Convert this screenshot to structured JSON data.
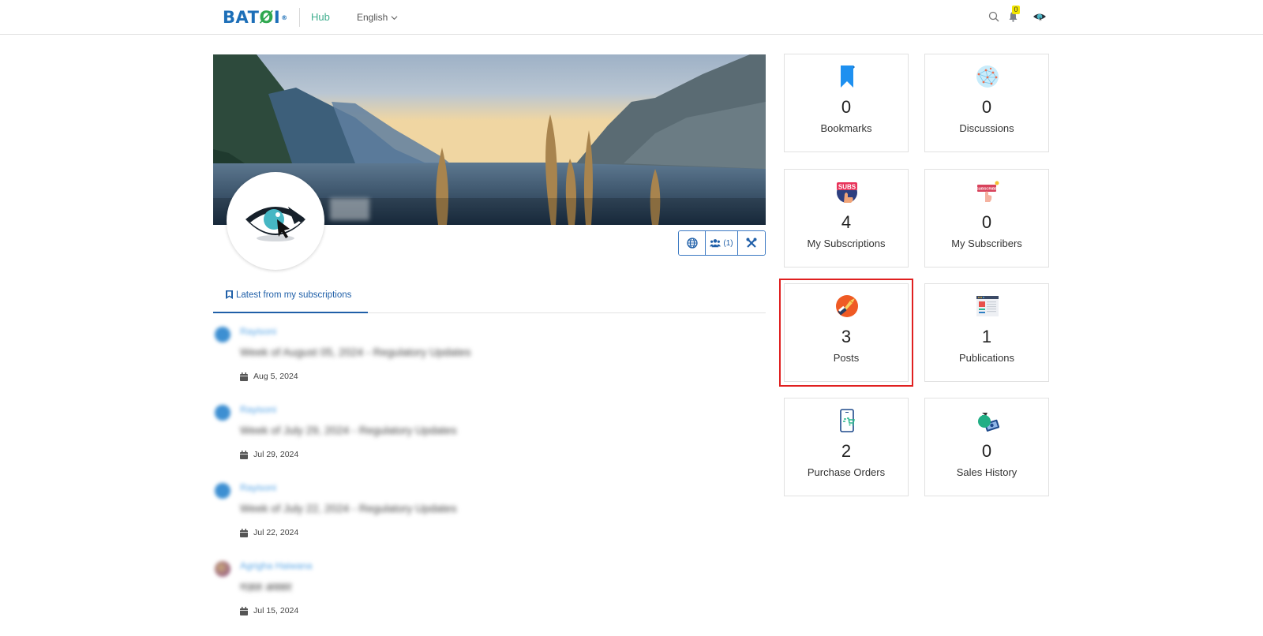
{
  "header": {
    "logo_text": "BATOI",
    "hub_label": "Hub",
    "language_label": "English",
    "notification_count": "0",
    "icons": {
      "search": "search-icon",
      "bell": "bell-icon",
      "avatar": "eye-logo-avatar",
      "chevron": "chevron-down-icon"
    }
  },
  "profile": {
    "banner_alt": "Lake and mountains banner",
    "avatar_icon": "eye-cursor-logo",
    "actions": [
      {
        "name": "public-profile",
        "icon": "globe-icon",
        "label": ""
      },
      {
        "name": "members",
        "icon": "members-icon",
        "label": "(1)"
      },
      {
        "name": "settings",
        "icon": "tools-icon",
        "label": ""
      }
    ]
  },
  "tabs": [
    {
      "label": "Latest from my subscriptions",
      "icon": "bookmark-icon",
      "active": true
    }
  ],
  "feed": [
    {
      "author": "Rayisoni",
      "title": "Week of August 05, 2024 - Regulatory Updates",
      "date": "Aug 5, 2024"
    },
    {
      "author": "Rayisoni",
      "title": "Week of July 29, 2024 - Regulatory Updates",
      "date": "Jul 29, 2024"
    },
    {
      "author": "Rayisoni",
      "title": "Week of July 22, 2024 - Regulatory Updates",
      "date": "Jul 22, 2024"
    },
    {
      "author": "Agrigha Haiwana",
      "title": "गज़ल अवसर",
      "date": "Jul 15, 2024"
    }
  ],
  "stats": [
    {
      "key": "bookmarks",
      "count": "0",
      "label": "Bookmarks",
      "icon": "bookmark-icon"
    },
    {
      "key": "discussions",
      "count": "0",
      "label": "Discussions",
      "icon": "network-globe-icon"
    },
    {
      "key": "my-subscriptions",
      "count": "4",
      "label": "My Subscriptions",
      "icon": "subscribe-hand-icon"
    },
    {
      "key": "my-subscribers",
      "count": "0",
      "label": "My Subscribers",
      "icon": "subscribe-button-icon"
    },
    {
      "key": "posts",
      "count": "3",
      "label": "Posts",
      "icon": "pen-nib-icon",
      "highlighted": true
    },
    {
      "key": "publications",
      "count": "1",
      "label": "Publications",
      "icon": "browser-page-icon"
    },
    {
      "key": "purchase-orders",
      "count": "2",
      "label": "Purchase Orders",
      "icon": "mobile-cart-icon"
    },
    {
      "key": "sales-history",
      "count": "0",
      "label": "Sales History",
      "icon": "money-bag-icon"
    }
  ],
  "colors": {
    "brand_blue": "#1d6fb8",
    "hub_green": "#3fae8e",
    "link_blue": "#1f5fa8",
    "highlight_red": "#e02020",
    "badge_yellow": "#f3e600"
  }
}
